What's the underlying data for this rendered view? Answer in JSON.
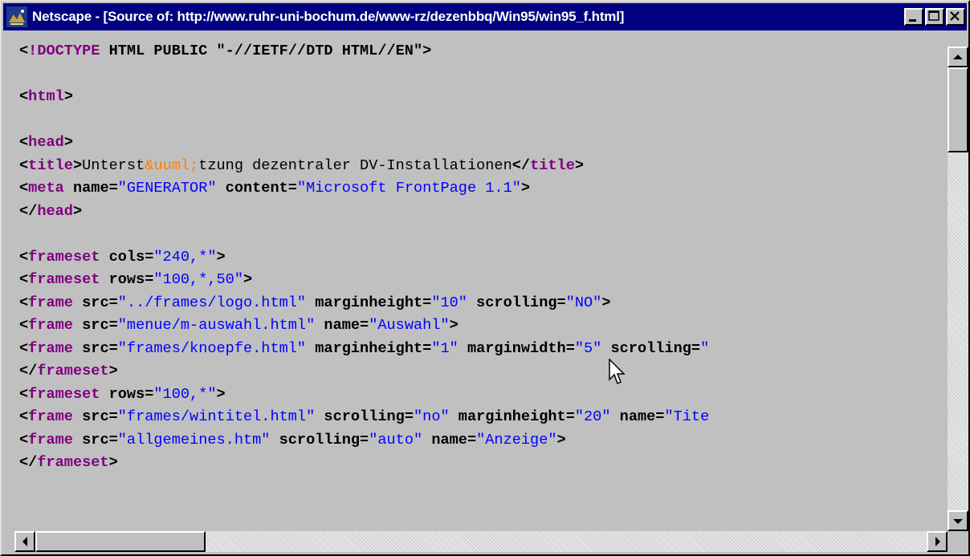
{
  "window": {
    "title": "Netscape - [Source of: http://www.ruhr-uni-bochum.de/www-rz/dezenbbq/Win95/win95_f.html]",
    "icon": "netscape-logo-icon",
    "buttons": [
      "minimize-icon",
      "maximize-icon",
      "close-icon"
    ]
  },
  "source_lines": [
    [
      {
        "c": "tag",
        "t": "<"
      },
      {
        "c": "kw",
        "t": "!DOCTYPE"
      },
      {
        "c": "attr",
        "t": " HTML PUBLIC \"-//IETF//DTD HTML//EN\""
      },
      {
        "c": "tag",
        "t": ">"
      }
    ],
    [],
    [
      {
        "c": "tag",
        "t": "<"
      },
      {
        "c": "kw",
        "t": "html"
      },
      {
        "c": "tag",
        "t": ">"
      }
    ],
    [],
    [
      {
        "c": "tag",
        "t": "<"
      },
      {
        "c": "kw",
        "t": "head"
      },
      {
        "c": "tag",
        "t": ">"
      }
    ],
    [
      {
        "c": "tag",
        "t": "<"
      },
      {
        "c": "kw",
        "t": "title"
      },
      {
        "c": "tag",
        "t": ">"
      },
      {
        "c": "txt",
        "t": "Unterst"
      },
      {
        "c": "ent",
        "t": "&uuml;"
      },
      {
        "c": "txt",
        "t": "tzung dezentraler DV-Installationen"
      },
      {
        "c": "tag",
        "t": "</"
      },
      {
        "c": "kw",
        "t": "title"
      },
      {
        "c": "tag",
        "t": ">"
      }
    ],
    [
      {
        "c": "tag",
        "t": "<"
      },
      {
        "c": "kw",
        "t": "meta"
      },
      {
        "c": "attr",
        "t": " name="
      },
      {
        "c": "val",
        "t": "\"GENERATOR\""
      },
      {
        "c": "attr",
        "t": " content="
      },
      {
        "c": "val",
        "t": "\"Microsoft FrontPage 1.1\""
      },
      {
        "c": "tag",
        "t": ">"
      }
    ],
    [
      {
        "c": "tag",
        "t": "</"
      },
      {
        "c": "kw",
        "t": "head"
      },
      {
        "c": "tag",
        "t": ">"
      }
    ],
    [],
    [
      {
        "c": "tag",
        "t": "<"
      },
      {
        "c": "kw",
        "t": "frameset"
      },
      {
        "c": "attr",
        "t": " cols="
      },
      {
        "c": "val",
        "t": "\"240,*\""
      },
      {
        "c": "tag",
        "t": ">"
      }
    ],
    [
      {
        "c": "tag",
        "t": "<"
      },
      {
        "c": "kw",
        "t": "frameset"
      },
      {
        "c": "attr",
        "t": " rows="
      },
      {
        "c": "val",
        "t": "\"100,*,50\""
      },
      {
        "c": "tag",
        "t": ">"
      }
    ],
    [
      {
        "c": "tag",
        "t": "<"
      },
      {
        "c": "kw",
        "t": "frame"
      },
      {
        "c": "attr",
        "t": " src="
      },
      {
        "c": "val",
        "t": "\"../frames/logo.html\""
      },
      {
        "c": "attr",
        "t": " marginheight="
      },
      {
        "c": "val",
        "t": "\"10\""
      },
      {
        "c": "attr",
        "t": " scrolling="
      },
      {
        "c": "val",
        "t": "\"NO\""
      },
      {
        "c": "tag",
        "t": ">"
      }
    ],
    [
      {
        "c": "tag",
        "t": "<"
      },
      {
        "c": "kw",
        "t": "frame"
      },
      {
        "c": "attr",
        "t": " src="
      },
      {
        "c": "val",
        "t": "\"menue/m-auswahl.html\""
      },
      {
        "c": "attr",
        "t": " name="
      },
      {
        "c": "val",
        "t": "\"Auswahl\""
      },
      {
        "c": "tag",
        "t": ">"
      }
    ],
    [
      {
        "c": "tag",
        "t": "<"
      },
      {
        "c": "kw",
        "t": "frame"
      },
      {
        "c": "attr",
        "t": " src="
      },
      {
        "c": "val",
        "t": "\"frames/knoepfe.html\""
      },
      {
        "c": "attr",
        "t": " marginheight="
      },
      {
        "c": "val",
        "t": "\"1\""
      },
      {
        "c": "attr",
        "t": " marginwidth="
      },
      {
        "c": "val",
        "t": "\"5\""
      },
      {
        "c": "attr",
        "t": " scrolling="
      },
      {
        "c": "val",
        "t": "\""
      }
    ],
    [
      {
        "c": "tag",
        "t": "</"
      },
      {
        "c": "kw",
        "t": "frameset"
      },
      {
        "c": "tag",
        "t": ">"
      }
    ],
    [
      {
        "c": "tag",
        "t": "<"
      },
      {
        "c": "kw",
        "t": "frameset"
      },
      {
        "c": "attr",
        "t": " rows="
      },
      {
        "c": "val",
        "t": "\"100,*\""
      },
      {
        "c": "tag",
        "t": ">"
      }
    ],
    [
      {
        "c": "tag",
        "t": "<"
      },
      {
        "c": "kw",
        "t": "frame"
      },
      {
        "c": "attr",
        "t": " src="
      },
      {
        "c": "val",
        "t": "\"frames/wintitel.html\""
      },
      {
        "c": "attr",
        "t": " scrolling="
      },
      {
        "c": "val",
        "t": "\"no\""
      },
      {
        "c": "attr",
        "t": " marginheight="
      },
      {
        "c": "val",
        "t": "\"20\""
      },
      {
        "c": "attr",
        "t": " name="
      },
      {
        "c": "val",
        "t": "\"Tite"
      }
    ],
    [
      {
        "c": "tag",
        "t": "<"
      },
      {
        "c": "kw",
        "t": "frame"
      },
      {
        "c": "attr",
        "t": " src="
      },
      {
        "c": "val",
        "t": "\"allgemeines.htm\""
      },
      {
        "c": "attr",
        "t": " scrolling="
      },
      {
        "c": "val",
        "t": "\"auto\""
      },
      {
        "c": "attr",
        "t": " name="
      },
      {
        "c": "val",
        "t": "\"Anzeige\""
      },
      {
        "c": "tag",
        "t": ">"
      }
    ],
    [
      {
        "c": "tag",
        "t": "</"
      },
      {
        "c": "kw",
        "t": "frameset"
      },
      {
        "c": "tag",
        "t": ">"
      }
    ]
  ],
  "colors": {
    "titlebar": "#000080",
    "window_bg": "#c0c0c0",
    "keyword": "#800080",
    "value": "#0000ff",
    "entity": "#ff8000"
  }
}
